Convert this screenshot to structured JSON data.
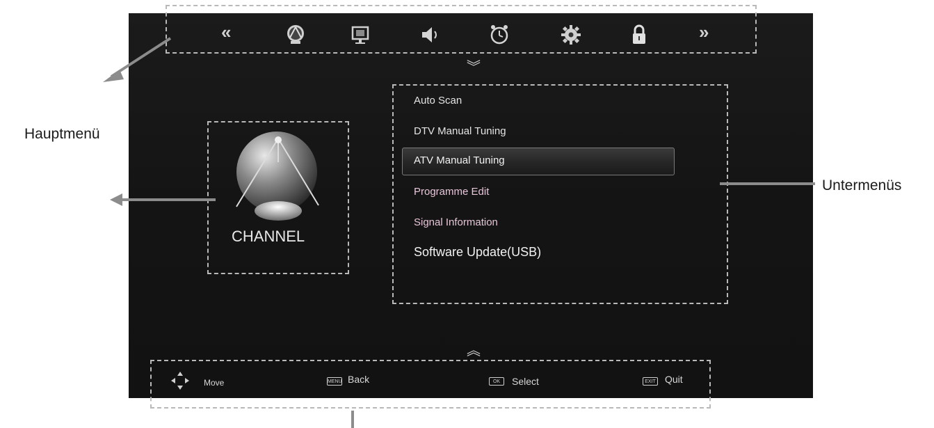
{
  "callouts": {
    "main_menu": "Hauptmenü",
    "submenus": "Untermenüs"
  },
  "top_bar": {
    "left_arrow": "«",
    "right_arrow": "»",
    "icons": [
      "channel-icon",
      "picture-icon",
      "sound-icon",
      "time-icon",
      "setup-icon",
      "lock-icon"
    ]
  },
  "scroll": {
    "down": "︾",
    "up": "︽"
  },
  "main_menu": {
    "label": "CHANNEL"
  },
  "submenu": {
    "items": [
      "Auto Scan",
      "DTV Manual Tuning",
      "ATV Manual Tuning",
      "Programme Edit",
      "Signal Information",
      "Software Update(USB)"
    ],
    "selected": "ATV Manual Tuning"
  },
  "help_bar": {
    "move": "Move",
    "back_key": "MENU",
    "back": "Back",
    "select_key": "OK",
    "select": "Select",
    "quit_key": "EXIT",
    "quit": "Quit"
  },
  "colors": {
    "screen_bg": "#161616",
    "text": "#e4e4e4",
    "pink_text": "#e7c5d8",
    "dash": "#b9b9b9"
  }
}
